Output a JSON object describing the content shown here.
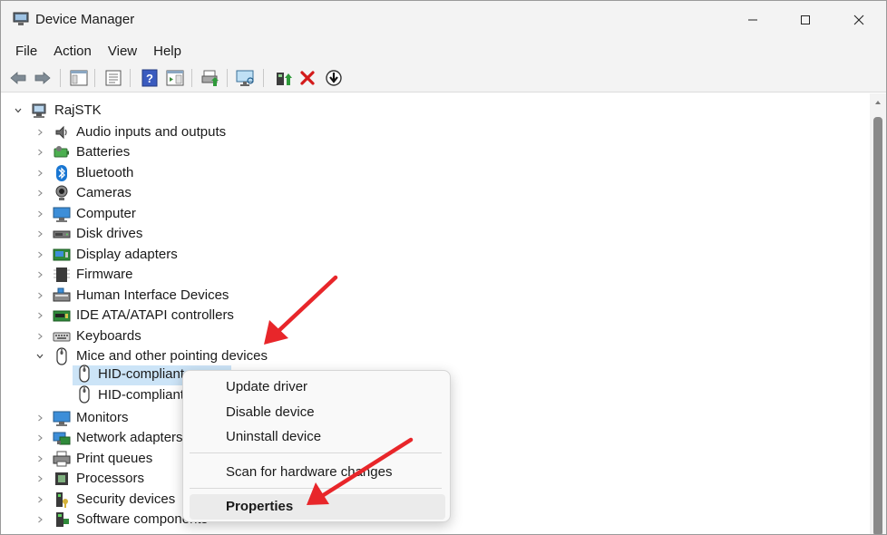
{
  "window": {
    "title": "Device Manager"
  },
  "menu": [
    "File",
    "Action",
    "View",
    "Help"
  ],
  "tree": {
    "root": "RajSTK",
    "categories": [
      {
        "label": "Audio inputs and outputs",
        "icon": "speaker-icon"
      },
      {
        "label": "Batteries",
        "icon": "battery-icon"
      },
      {
        "label": "Bluetooth",
        "icon": "bluetooth-icon"
      },
      {
        "label": "Cameras",
        "icon": "camera-icon"
      },
      {
        "label": "Computer",
        "icon": "computer-icon"
      },
      {
        "label": "Disk drives",
        "icon": "disk-drive-icon"
      },
      {
        "label": "Display adapters",
        "icon": "display-adapter-icon"
      },
      {
        "label": "Firmware",
        "icon": "firmware-icon"
      },
      {
        "label": "Human Interface Devices",
        "icon": "hid-icon"
      },
      {
        "label": "IDE ATA/ATAPI controllers",
        "icon": "ide-controller-icon"
      },
      {
        "label": "Keyboards",
        "icon": "keyboard-icon"
      },
      {
        "label": "Mice and other pointing devices",
        "icon": "mouse-icon"
      },
      {
        "label": "Monitors",
        "icon": "monitor-icon"
      },
      {
        "label": "Network adapters",
        "icon": "network-adapter-icon"
      },
      {
        "label": "Print queues",
        "icon": "printer-icon"
      },
      {
        "label": "Processors",
        "icon": "processor-icon"
      },
      {
        "label": "Security devices",
        "icon": "security-device-icon"
      },
      {
        "label": "Software components",
        "icon": "software-component-icon"
      }
    ],
    "mice_children": [
      "HID-compliant",
      "HID-compliant"
    ]
  },
  "context_menu": {
    "update_driver": "Update driver",
    "disable_device": "Disable device",
    "uninstall_device": "Uninstall device",
    "scan_hardware": "Scan for hardware changes",
    "properties": "Properties"
  },
  "colors": {
    "accent_selection": "#cce4f7",
    "annotation_arrow": "#e8262a",
    "chrome": "#f3f3f3"
  }
}
